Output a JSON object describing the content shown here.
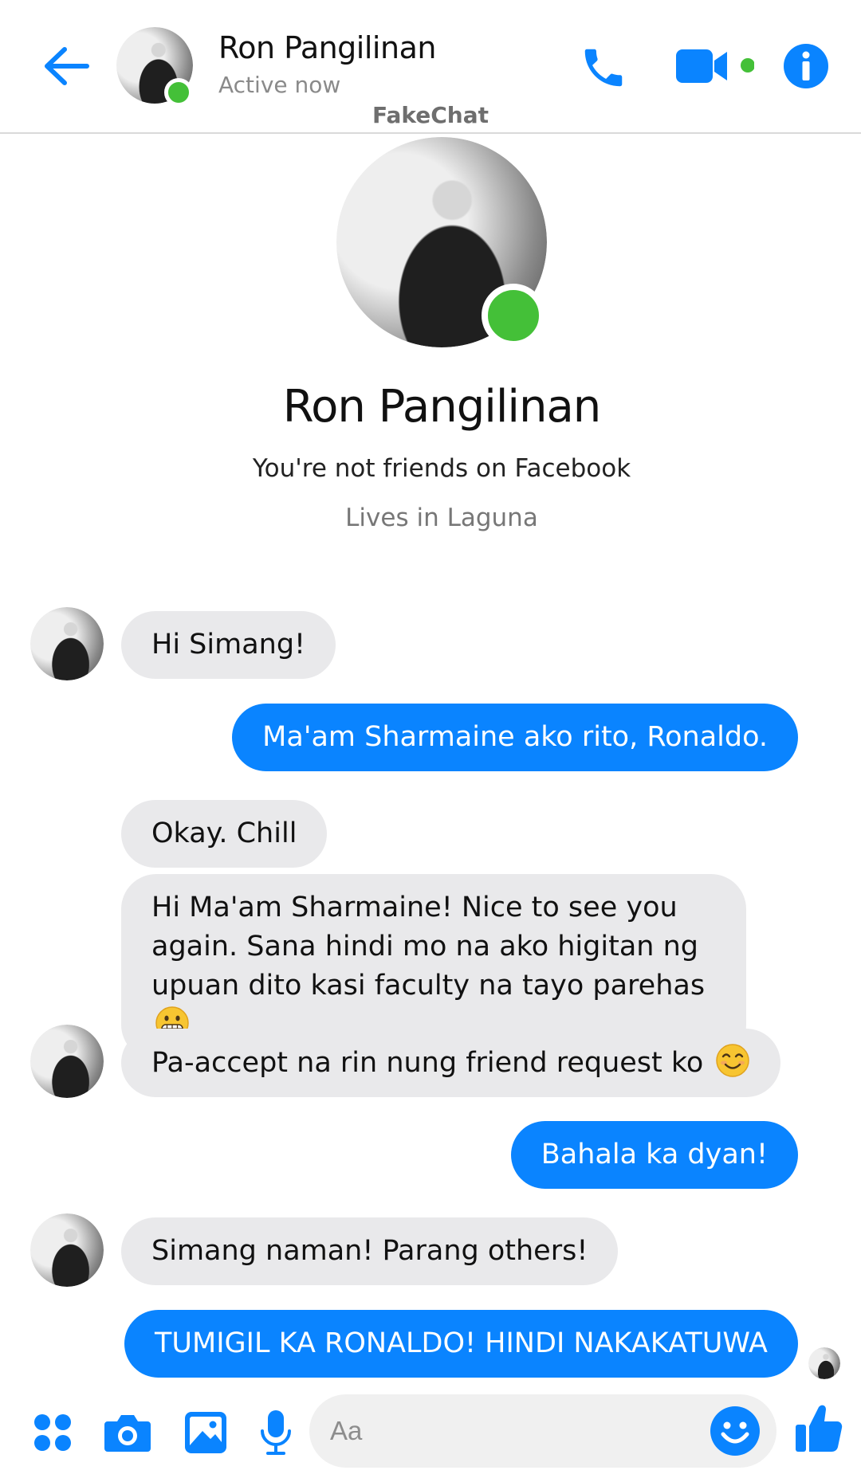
{
  "header": {
    "name": "Ron Pangilinan",
    "status": "Active now",
    "watermark": "FakeChat"
  },
  "profile": {
    "name": "Ron Pangilinan",
    "friend_status": "You're not friends on Facebook",
    "location": "Lives in Laguna"
  },
  "messages": [
    {
      "from": "them",
      "text": "Hi Simang!"
    },
    {
      "from": "me",
      "text": "Ma'am Sharmaine ako rito, Ronaldo."
    },
    {
      "from": "them",
      "text": "Okay. Chill"
    },
    {
      "from": "them",
      "text": "Hi Ma'am Sharmaine! Nice to see you again. Sana hindi mo na ako higitan ng upuan dito kasi faculty na tayo parehas",
      "emoji": "grimacing-face"
    },
    {
      "from": "them",
      "text": "Pa-accept na rin nung friend request ko",
      "emoji": "smiling-face"
    },
    {
      "from": "me",
      "text": "Bahala ka dyan!"
    },
    {
      "from": "them",
      "text": "Simang naman! Parang others!"
    },
    {
      "from": "me",
      "text": "TUMIGIL KA RONALDO! HINDI NAKAKATUWA"
    }
  ],
  "composer": {
    "placeholder": "Aa"
  },
  "colors": {
    "accent": "#0a84ff",
    "online": "#44c038",
    "incoming_bubble": "#e9e9eb"
  },
  "icons": [
    "back-arrow-icon",
    "phone-icon",
    "video-camera-icon",
    "info-icon",
    "apps-grid-icon",
    "camera-icon",
    "image-icon",
    "microphone-icon",
    "emoji-icon",
    "thumbs-up-icon"
  ]
}
